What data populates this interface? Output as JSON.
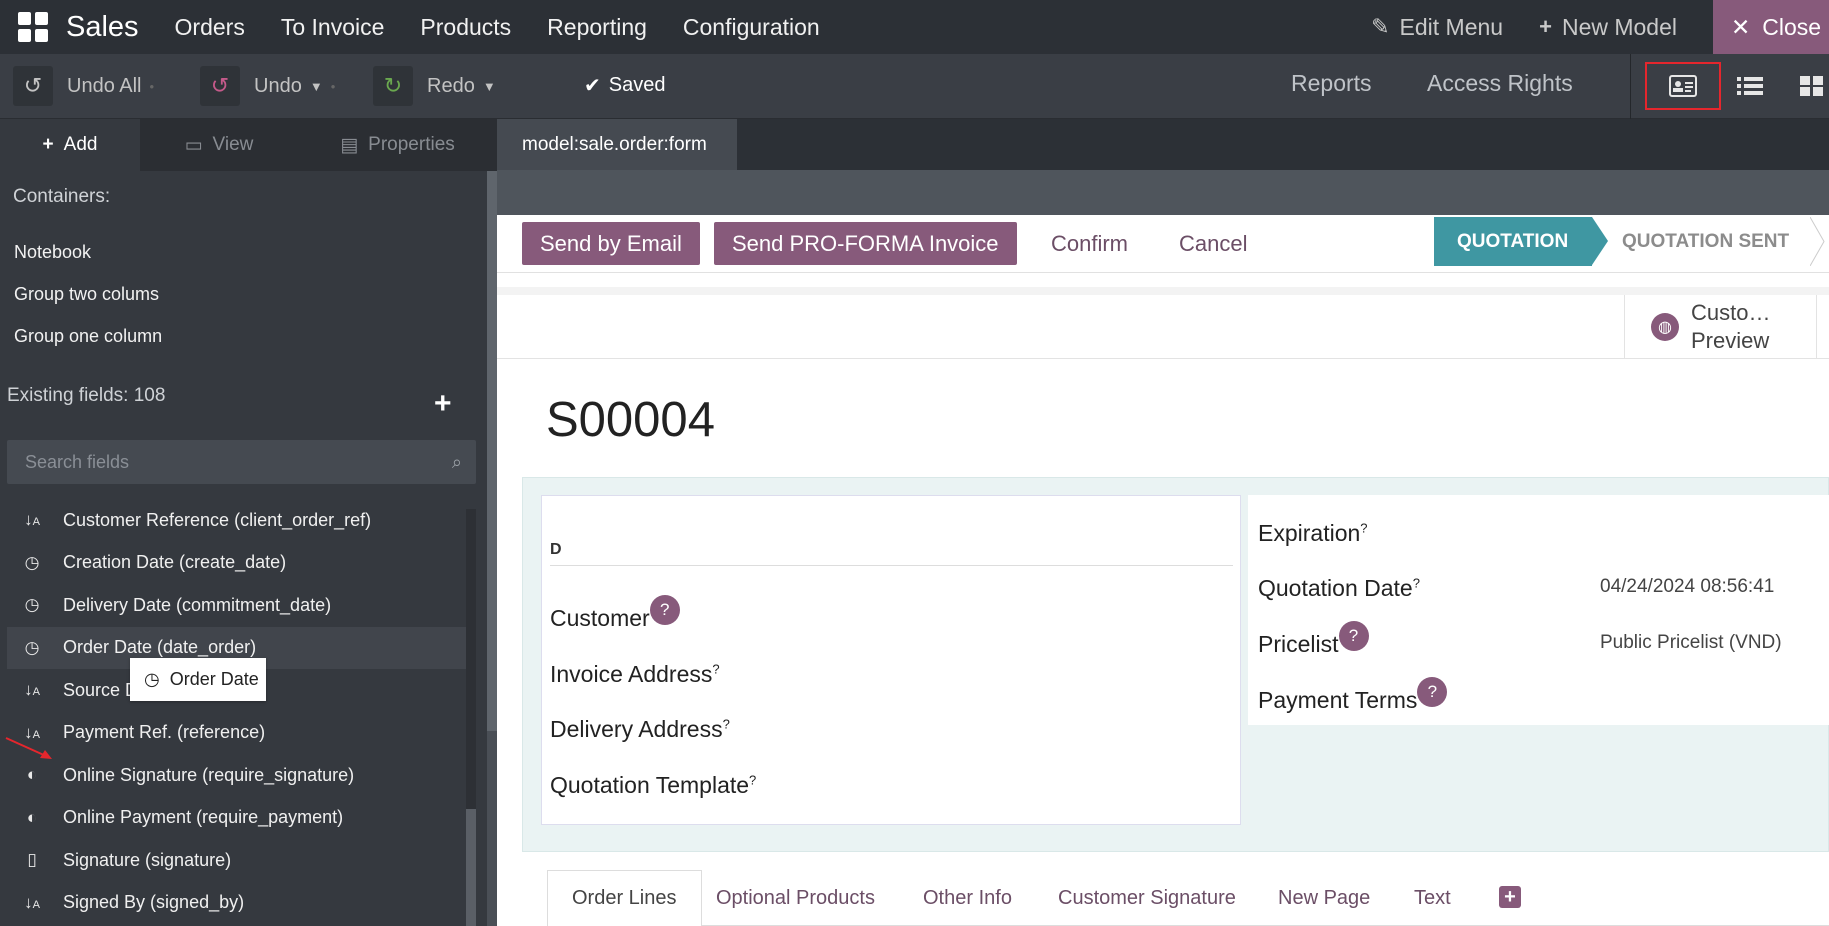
{
  "navbar": {
    "brand": "Sales",
    "menu": [
      "Orders",
      "To Invoice",
      "Products",
      "Reporting",
      "Configuration"
    ],
    "edit_menu": "Edit Menu",
    "new_model": "New Model",
    "close": "Close"
  },
  "toolbar": {
    "undo_all": "Undo All",
    "undo": "Undo",
    "redo": "Redo",
    "saved": "Saved",
    "reports": "Reports",
    "access_rights": "Access Rights"
  },
  "sidebar": {
    "tabs": {
      "add": "Add",
      "view": "View",
      "properties": "Properties"
    },
    "containers_label": "Containers:",
    "containers": [
      "Notebook",
      "Group two colums",
      "Group one column"
    ],
    "existing_fields": "Existing fields: 108",
    "search_placeholder": "Search fields",
    "fields": [
      {
        "icon": "sort-alpha-icon",
        "label": "Customer Reference (client_order_ref)"
      },
      {
        "icon": "clock-icon",
        "label": "Creation Date (create_date)"
      },
      {
        "icon": "clock-icon",
        "label": "Delivery Date (commitment_date)"
      },
      {
        "icon": "clock-icon",
        "label": "Order Date (date_order)"
      },
      {
        "icon": "sort-alpha-icon",
        "label": "Source D"
      },
      {
        "icon": "sort-alpha-icon",
        "label": "Payment Ref. (reference)"
      },
      {
        "icon": "toggle-icon",
        "label": "Online Signature (require_signature)"
      },
      {
        "icon": "toggle-icon",
        "label": "Online Payment (require_payment)"
      },
      {
        "icon": "file-icon",
        "label": "Signature (signature)"
      },
      {
        "icon": "sort-alpha-icon",
        "label": "Signed By (signed_by)"
      }
    ],
    "drag_tooltip": "Order Date"
  },
  "main": {
    "tab": "model:sale.order:form",
    "buttons": {
      "send_email": "Send by Email",
      "send_proforma": "Send PRO-FORMA Invoice",
      "confirm": "Confirm",
      "cancel": "Cancel"
    },
    "stages": {
      "active": "QUOTATION",
      "next": "QUOTATION SENT"
    },
    "customer_preview": {
      "line1": "Custo…",
      "line2": "Preview"
    },
    "order_name": "S00004",
    "left_group": {
      "d_label": "D",
      "customer": "Customer",
      "invoice_address": "Invoice Address",
      "delivery_address": "Delivery Address",
      "quotation_template": "Quotation Template"
    },
    "right_group": {
      "expiration": "Expiration",
      "quotation_date": "Quotation Date",
      "quotation_date_value": "04/24/2024 08:56:41",
      "pricelist": "Pricelist",
      "pricelist_value": "Public Pricelist (VND)",
      "payment_terms": "Payment Terms"
    },
    "notebook_tabs": [
      "Order Lines",
      "Optional Products",
      "Other Info",
      "Customer Signature",
      "New Page",
      "Text"
    ]
  },
  "colors": {
    "brand_purple": "#875a7b",
    "stage_teal": "#3f97a2",
    "navbar": "#2c3036"
  }
}
